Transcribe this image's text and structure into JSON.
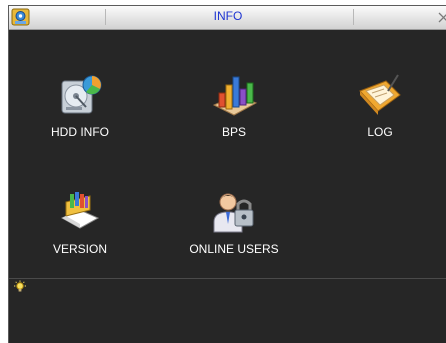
{
  "window": {
    "title": "INFO",
    "icons": {
      "app": "settings-info-icon",
      "close": "close-icon",
      "hint": "lightbulb-icon"
    }
  },
  "menu": {
    "items": [
      {
        "label": "HDD INFO",
        "icon": "hdd-icon"
      },
      {
        "label": "BPS",
        "icon": "bar-chart-icon"
      },
      {
        "label": "LOG",
        "icon": "log-folder-icon"
      },
      {
        "label": "VERSION",
        "icon": "version-box-icon"
      },
      {
        "label": "ONLINE USERS",
        "icon": "user-lock-icon"
      }
    ]
  },
  "status": {
    "text": ""
  },
  "colors": {
    "background": "#262626",
    "title_text": "#1d34d2",
    "label_text": "#ffffff"
  }
}
